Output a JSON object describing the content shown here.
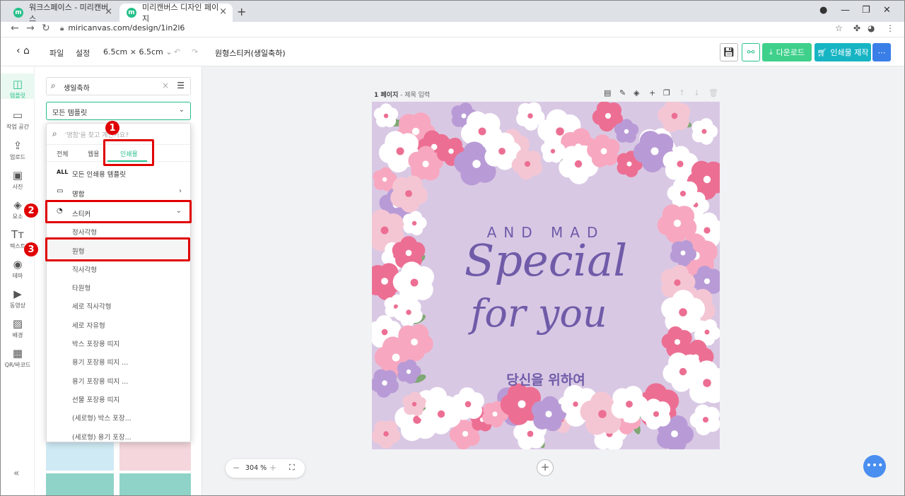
{
  "browser": {
    "tabs": [
      {
        "label": "워크스페이스 - 미리캔버스",
        "active": false
      },
      {
        "label": "미리캔버스 디자인 페이지",
        "active": true
      }
    ],
    "url": "miricanvas.com/design/1in2l6"
  },
  "toolbar": {
    "file": "파일",
    "settings": "설정",
    "size": "6.5cm × 6.5cm",
    "title": "원형스티커(생일축하)",
    "download": "다운로드",
    "print": "인쇄물 제작",
    "more": "⋯"
  },
  "rail": [
    {
      "label": "템플릿",
      "icon": "template-icon",
      "glyph": "◫"
    },
    {
      "label": "작업 공간",
      "icon": "archive-icon",
      "glyph": "▭"
    },
    {
      "label": "업로드",
      "icon": "upload-icon",
      "glyph": "⇪"
    },
    {
      "label": "사진",
      "icon": "photo-icon",
      "glyph": "▣"
    },
    {
      "label": "요소",
      "icon": "elements-icon",
      "glyph": "◈"
    },
    {
      "label": "텍스트",
      "icon": "text-icon",
      "glyph": "Tт"
    },
    {
      "label": "테마",
      "icon": "palette-icon",
      "glyph": "◉"
    },
    {
      "label": "동영상",
      "icon": "video-icon",
      "glyph": "▶"
    },
    {
      "label": "배경",
      "icon": "background-icon",
      "glyph": "▨"
    },
    {
      "label": "QR/바코드",
      "icon": "qr-icon",
      "glyph": "▦"
    }
  ],
  "panel": {
    "search_value": "생일축하",
    "select_value": "모든 템플릿"
  },
  "dropdown": {
    "search_placeholder": "'명함'을 찾고 계신가요?",
    "tabs": [
      "전체",
      "웹용",
      "인쇄용"
    ],
    "all_label": "모든 인쇄용 템플릿",
    "all_icon_text": "ALL",
    "card_label": "명함",
    "sticker_label": "스티커",
    "sub_items": [
      "정사각형",
      "원형",
      "직사각형",
      "타원형",
      "세로 직사각형",
      "세로 자유형",
      "박스 포장용 띠지",
      "용기 포장용 띠지 ...",
      "용기 포장용 띠지 ...",
      "선물 포장용 띠지",
      "(세로형) 박스 포장...",
      "(세로형) 용기 포장..."
    ]
  },
  "annotations": {
    "step1": "1",
    "step2": "2",
    "step3": "3"
  },
  "workspace": {
    "page_label": "1 페이지",
    "page_title_placeholder": "- 제목 입력",
    "zoom": "304 %"
  },
  "canvas": {
    "arc_text": "AND MAD",
    "line1": "Special",
    "line2": "for you",
    "korean": "당신을 위하여",
    "bg_color": "#d9c8e4",
    "text_color": "#6f5ba8"
  },
  "colors": {
    "accent": "#27c08a",
    "highlight": "#e00000"
  }
}
